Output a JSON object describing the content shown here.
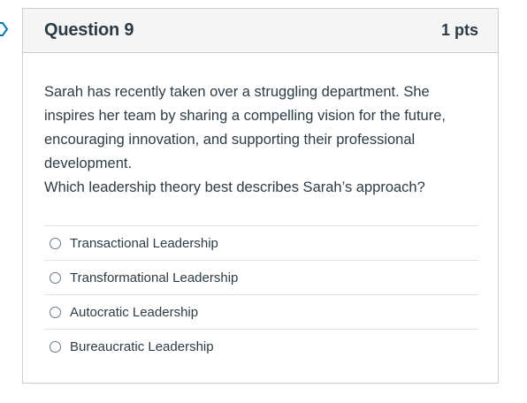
{
  "question": {
    "title": "Question 9",
    "points": "1 pts",
    "text_lines": [
      "Sarah has recently taken over a struggling department. She inspires her team by sharing a compelling vision for the future, encouraging innovation, and supporting their professional development.",
      "Which leadership theory best describes Sarah’s approach?"
    ],
    "answers": [
      {
        "label": "Transactional Leadership"
      },
      {
        "label": "Transformational Leadership"
      },
      {
        "label": "Autocratic Leadership"
      },
      {
        "label": "Bureaucratic Leadership"
      }
    ]
  },
  "colors": {
    "header_bg": "#f5f5f5",
    "border": "#c7cdd1",
    "text": "#2d3b45",
    "flag_outline": "#0374b5"
  },
  "icons": {
    "flag": "flag-outline-icon",
    "radio": "radio-unchecked-icon"
  }
}
